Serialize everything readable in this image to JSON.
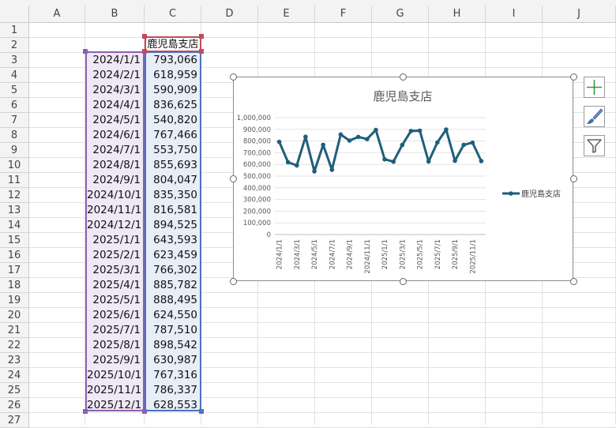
{
  "columns": [
    "A",
    "B",
    "C",
    "D",
    "E",
    "F",
    "G",
    "H",
    "I",
    "J"
  ],
  "rows": [
    "1",
    "2",
    "3",
    "4",
    "5",
    "6",
    "7",
    "8",
    "9",
    "10",
    "11",
    "12",
    "13",
    "14",
    "15",
    "16",
    "17",
    "18",
    "19",
    "20",
    "21",
    "22",
    "23",
    "24",
    "25",
    "26",
    "27"
  ],
  "header_cell": "鹿児島支店",
  "table": {
    "dates": [
      "2024/1/1",
      "2024/2/1",
      "2024/3/1",
      "2024/4/1",
      "2024/5/1",
      "2024/6/1",
      "2024/7/1",
      "2024/8/1",
      "2024/9/1",
      "2024/10/1",
      "2024/11/1",
      "2024/12/1",
      "2025/1/1",
      "2025/2/1",
      "2025/3/1",
      "2025/4/1",
      "2025/5/1",
      "2025/6/1",
      "2025/7/1",
      "2025/8/1",
      "2025/9/1",
      "2025/10/1",
      "2025/11/1",
      "2025/12/1"
    ],
    "values": [
      "793,066",
      "618,959",
      "590,909",
      "836,625",
      "540,820",
      "767,466",
      "553,750",
      "855,693",
      "804,047",
      "835,350",
      "816,581",
      "894,525",
      "643,593",
      "623,459",
      "766,302",
      "885,782",
      "888,495",
      "624,550",
      "787,510",
      "898,542",
      "630,987",
      "767,316",
      "786,337",
      "628,553"
    ]
  },
  "chart_data": {
    "type": "line",
    "title": "鹿児島支店",
    "x": [
      "2024/1/1",
      "2024/2/1",
      "2024/3/1",
      "2024/4/1",
      "2024/5/1",
      "2024/6/1",
      "2024/7/1",
      "2024/8/1",
      "2024/9/1",
      "2024/10/1",
      "2024/11/1",
      "2024/12/1",
      "2025/1/1",
      "2025/2/1",
      "2025/3/1",
      "2025/4/1",
      "2025/5/1",
      "2025/6/1",
      "2025/7/1",
      "2025/8/1",
      "2025/9/1",
      "2025/10/1",
      "2025/11/1",
      "2025/12/1"
    ],
    "x_tick_labels": [
      "2024/1/1",
      "2024/3/1",
      "2024/5/1",
      "2024/7/1",
      "2024/9/1",
      "2024/11/1",
      "2025/1/1",
      "2025/3/1",
      "2025/5/1",
      "2025/7/1",
      "2025/9/1",
      "2025/11/1"
    ],
    "series": [
      {
        "name": "鹿児島支店",
        "values": [
          793066,
          618959,
          590909,
          836625,
          540820,
          767466,
          553750,
          855693,
          804047,
          835350,
          816581,
          894525,
          643593,
          623459,
          766302,
          885782,
          888495,
          624550,
          787510,
          898542,
          630987,
          767316,
          786337,
          628553
        ]
      }
    ],
    "ylim": [
      0,
      1000000
    ],
    "y_tick_labels": [
      "0",
      "100,000",
      "200,000",
      "300,000",
      "400,000",
      "500,000",
      "600,000",
      "700,000",
      "800,000",
      "900,000",
      "1,000,000"
    ],
    "grid": true,
    "legend": "right",
    "color": "#1f5f7a"
  },
  "side_buttons": [
    "plus-icon",
    "brush-icon",
    "filter-icon"
  ]
}
